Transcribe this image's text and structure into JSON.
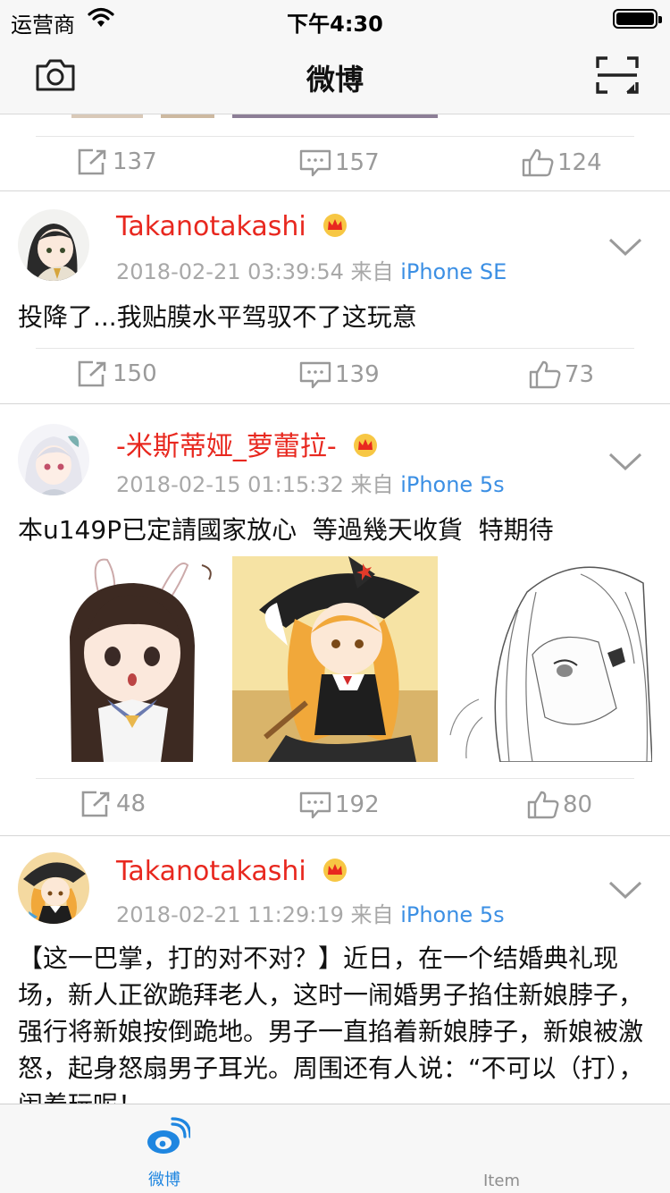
{
  "status_bar": {
    "carrier": "运营商",
    "time": "下午4:30"
  },
  "navbar": {
    "title": "微博"
  },
  "first_actions": {
    "repost": "137",
    "comment": "157",
    "like": "124"
  },
  "posts": [
    {
      "username": "Takanotakashi",
      "time": "2018-02-21 03:39:54",
      "from_label": "来自",
      "source": "iPhone SE",
      "text": "投降了...我贴膜水平驾驭不了这玩意",
      "repost": "150",
      "comment": "139",
      "like": "73"
    },
    {
      "username": "-米斯蒂娅_萝蕾拉-",
      "time": "2018-02-15 01:15:32",
      "from_label": "来自",
      "source": "iPhone 5s",
      "text": "本u149P已定請國家放心  等過幾天收貨  特期待",
      "repost": "48",
      "comment": "192",
      "like": "80"
    },
    {
      "username": "Takanotakashi",
      "time": "2018-02-21 11:29:19",
      "from_label": "来自",
      "source": "iPhone 5s",
      "text": "【这一巴掌，打的对不对？】近日，在一个结婚典礼现场，新人正欲跪拜老人，这时一闹婚男子掐住新娘脖子，强行将新娘按倒跪地。男子一直掐着新娘脖子，新娘被激怒，起身怒扇男子耳光。周围还有人说：“不可以（打），闹着玩呢！"
    }
  ],
  "tabbar": {
    "tab1": "微博",
    "tab2": "Item"
  },
  "colors": {
    "username": "#e8281f",
    "source": "#3b8fe4",
    "tab_active": "#1f86e0",
    "meta": "#a8a8a8"
  }
}
